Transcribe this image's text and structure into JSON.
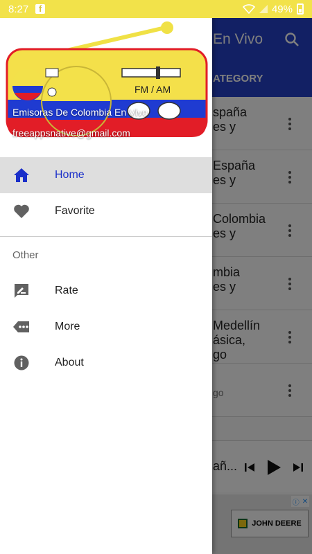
{
  "status_bar": {
    "time": "8:27",
    "battery": "49%"
  },
  "drawer": {
    "app_name": "Emisoras De Colombia En Vivo",
    "email": "freeappsnative@gmail.com",
    "logo_text": "FM / AM",
    "items": [
      {
        "label": "Home",
        "icon": "home-icon",
        "active": true
      },
      {
        "label": "Favorite",
        "icon": "heart-icon",
        "active": false
      }
    ],
    "section_label": "Other",
    "other_items": [
      {
        "label": "Rate",
        "icon": "rate-icon"
      },
      {
        "label": "More",
        "icon": "more-icon"
      },
      {
        "label": "About",
        "icon": "info-icon"
      }
    ]
  },
  "background": {
    "toolbar_title": "En Vivo",
    "tab_label": "ATEGORY",
    "stations": [
      {
        "line1": "spaña",
        "line2": "es y"
      },
      {
        "line1": "España",
        "line2": "es y"
      },
      {
        "line1": "Colombia",
        "line2": "es y"
      },
      {
        "line1": "mbia",
        "line2": "es y"
      },
      {
        "line1": "Medellín",
        "line2": "ásica,",
        "line3": "go"
      },
      {
        "line1": "",
        "line2": "go"
      }
    ],
    "player_text": "añ...",
    "ad_text": "JOHN DEERE"
  },
  "colors": {
    "status_bar": "#f2e24a",
    "toolbar": "#2440c8",
    "accent": "#1a2fc9"
  }
}
